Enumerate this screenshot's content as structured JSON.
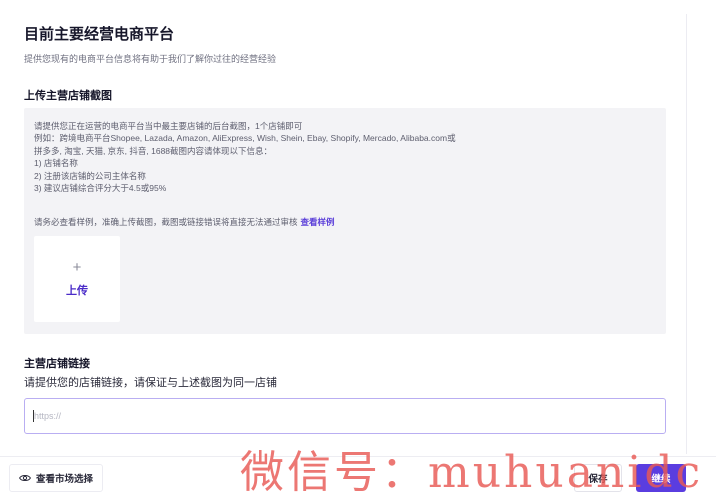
{
  "header": {
    "title": "目前主要经营电商平台",
    "subtitle": "提供您现有的电商平台信息将有助于我们了解你过往的经营经验"
  },
  "upload_section": {
    "title": "上传主营店铺截图",
    "lines": [
      "请提供您正在运营的电商平台当中最主要店铺的后台截图，1个店铺即可",
      "例如：跨境电商平台Shopee, Lazada, Amazon, AliExpress, Wish, Shein, Ebay, Shopify, Mercado, Alibaba.com或",
      "拼多多, 淘宝, 天猫, 京东, 抖音, 1688截图内容请体现以下信息：",
      "1) 店铺名称",
      "2) 注册该店铺的公司主体名称",
      "3) 建议店铺综合评分大于4.5或95%"
    ],
    "note": "请务必查看样例，准确上传截图，截图或链接错误将直接无法通过审核",
    "sample_link": "查看样例",
    "upload_plus": "+",
    "upload_label": "上传"
  },
  "link_section": {
    "title": "主营店铺链接",
    "subtitle": "请提供您的店铺链接，请保证与上述截图为同一店铺",
    "placeholder": "https://",
    "value": ""
  },
  "footer": {
    "market_label": "查看市场选择",
    "save_label": "保存",
    "continue_label": "继续"
  },
  "watermark": "微信号：muhuanidc",
  "colors": {
    "accent": "#5a3de0",
    "link": "#5b3fd9",
    "panel_bg": "#f3f3f6",
    "input_border": "#b9aef2",
    "watermark": "#e95a55"
  }
}
